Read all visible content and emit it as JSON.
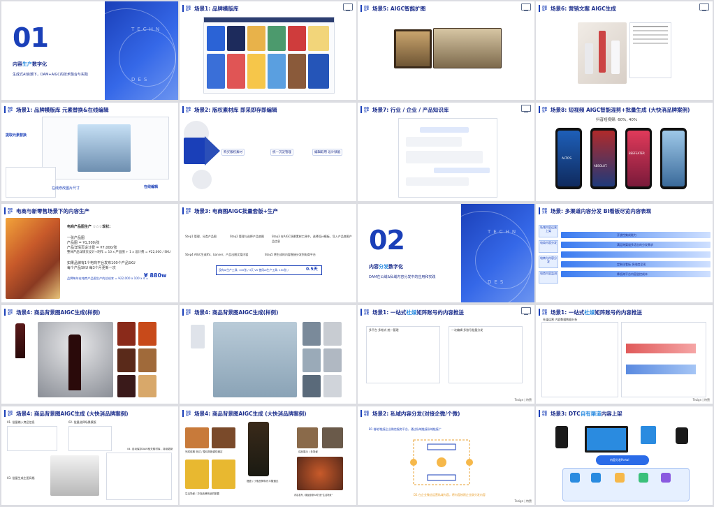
{
  "slides": {
    "s1": {
      "number": "01",
      "title_pre": "内容",
      "title_hl": "生产",
      "title_post": "数字化",
      "subtitle": "生成式AI浪潮下，DAM+AIGC的技术融合与实践",
      "deco1": "TECHN",
      "deco2": "DES"
    },
    "s2": {
      "title": "场景1: 品牌模版库",
      "tag": "内容生产"
    },
    "s3": {
      "title": "场景5: AIGC智能扩图",
      "tag": "内容生产"
    },
    "s4": {
      "title": "场景6: 营销文案 AIGC生成",
      "tag": "内容生产"
    },
    "s5": {
      "title": "场景1: 品牌模版库 元素替换&在线编辑",
      "tag": "内容生产",
      "label_a": "提取元素替换",
      "label_b": "在线编辑",
      "label_c": "在线修改图片尺寸"
    },
    "s6": {
      "title": "场景2: 版权素材库 即采即存即编辑",
      "tag": "内容生产",
      "step1": "购买版权素材",
      "step2": "统一沉淀管理",
      "step3": "编辑取用 设计赋能"
    },
    "s7": {
      "title": "场景7: 行业 / 企业 / 产品知识库",
      "tag": "内容生产"
    },
    "s8": {
      "title": "场景8: 短视频 AIGC智能混剪+批量生成 (大快消品牌案例)",
      "tag": "内容生产",
      "metric_label": "抖音短视频:",
      "metric_a": "60%,",
      "metric_b": "40%",
      "phone1": "ALTOS",
      "phone2": "ABSOLUT.",
      "phone3": "BEEFEATER"
    },
    "s9": {
      "title": "电商与新零售场景下的内容生产",
      "tag": "内容生产",
      "lines": [
        "电商产品图生产 ☆☆☆现状:",
        "一张产品图",
        "产品图 = ¥1,500/张",
        "产品详情页设计费 = ¥7,000/张",
        "整体产品详情页设计+制作 = 10 x 产品图 + 1 x 设计费 = ¥22,000 / SKU",
        "如果品牌有1个电商平台发布100个产品SKU",
        "每个产品SKU 每3个月更新一次",
        "品牌每年在电商产品图生产的总成本 = ¥22,000 x 100 x 4 ="
      ],
      "total": "¥ 880w"
    },
    "s10": {
      "title": "场景3: 电商图AIGC批量套版+生产",
      "tag": "内容生产",
      "steps": [
        "Step1 管理、分类产品图",
        "Step2 管理与选择产品底图",
        "Step3 在AIGC场景素材工具中，选择设计模板，导入产品底图产品信息",
        "Step4 AIGC生成KV、banner、产品出图文案内容",
        "Step5 将生成的内容直接分发到电商平台"
      ],
      "result_label": "没有AI生产工具: 100张 / 3天 VS 使用AI生产工具: 150张 /",
      "result_value": "0.5天"
    },
    "s11": {
      "number": "02",
      "title_pre": "内容",
      "title_hl": "分发",
      "title_post": "数字化",
      "subtitle": "DAM在公域&私域内容分发中的应用和实践",
      "deco1": "TECHN",
      "deco2": "DES"
    },
    "s12": {
      "title": "场景: 多渠道内容分发 BI看板尽览内容表现",
      "tag": "内容分发",
      "left": [
        "私域内容运营上架",
        "电商内容分发",
        "电商内容分发推广",
        "电商与内容分发",
        "电商内容监测"
      ],
      "rows": [
        "开放性集成能力",
        "满足跨渠道多语言的分发需求",
        "",
        "定制化看板 多维度呈现",
        "降低跨平台内容监控成本"
      ]
    },
    "s13": {
      "title": "场景4: 商品背景图AIGC生成(样例)",
      "tag": "内容生产"
    },
    "s14": {
      "title": "场景4: 商品背景图AIGC生成(样例)",
      "tag": "内容生产"
    },
    "s15": {
      "title_pre": "场景1: 一站式",
      "title_hl": "社媒",
      "title_post": "矩阵账号的内容推送",
      "tag": "内容分发",
      "panel_a": "多平台 多帐式 统一管理",
      "panel_b": "一次编辑 多账号批量分发"
    },
    "s16": {
      "title_pre": "场景1: 一站式",
      "title_hl": "社媒",
      "title_post": "矩阵账号的内容推送",
      "tag": "内容分发",
      "panel": "社媒运营 内容数据数据分析"
    },
    "s17": {
      "title": "场景4: 商品背景图AIGC生成 (大快消品牌案例)",
      "tag": "内容生产",
      "l1": "01. 批量输入商品信息",
      "l2": "02. 批量选择场景模版",
      "l3": "03. 批量生成主图风格",
      "l4": "04. 自动保存DAM相关素材库，持续更新"
    },
    "s18": {
      "title": "场景4: 商品背景图AIGC生成 (大快消品牌案例)",
      "tag": "内容生产",
      "c1": "完成前期 测试 / 整体风格调性确定",
      "c2": "组合 / 小瓶品牌标识平替",
      "c3": "成品展示 / 多场景",
      "c4": "生活场景 / 冲泡品牌商品的配置",
      "c5": "摆盘 / 小瓶品牌标识平替遇见",
      "c6": "内容发布  / 展品剖析AR打造\"生活场景\""
    },
    "s19": {
      "title": "场景2: 私域内容分发(对接企微/个微)",
      "tag": "内容分发",
      "top": "B1 借助/链接企业微信服务平台，通过私域链接私域链接广",
      "bottom": "D1 在企业微信运营私域内容，将内容按照企业群分发内容"
    },
    "s20": {
      "title_pre": "场景3: DTC",
      "title_hl": "自有渠道",
      "title_post": "内容上架",
      "tag": "内容分发",
      "portal": "内容分发Portal"
    },
    "footer": "Tezign | 特赞"
  },
  "colors": {
    "brand": "#1a3fb8",
    "accent": "#2a8be0",
    "gradient_end": "#6d95f0"
  },
  "icons": [
    "monitor-icon",
    "arrow-right-icon",
    "phone-icon",
    "laptop-icon",
    "watch-icon"
  ]
}
